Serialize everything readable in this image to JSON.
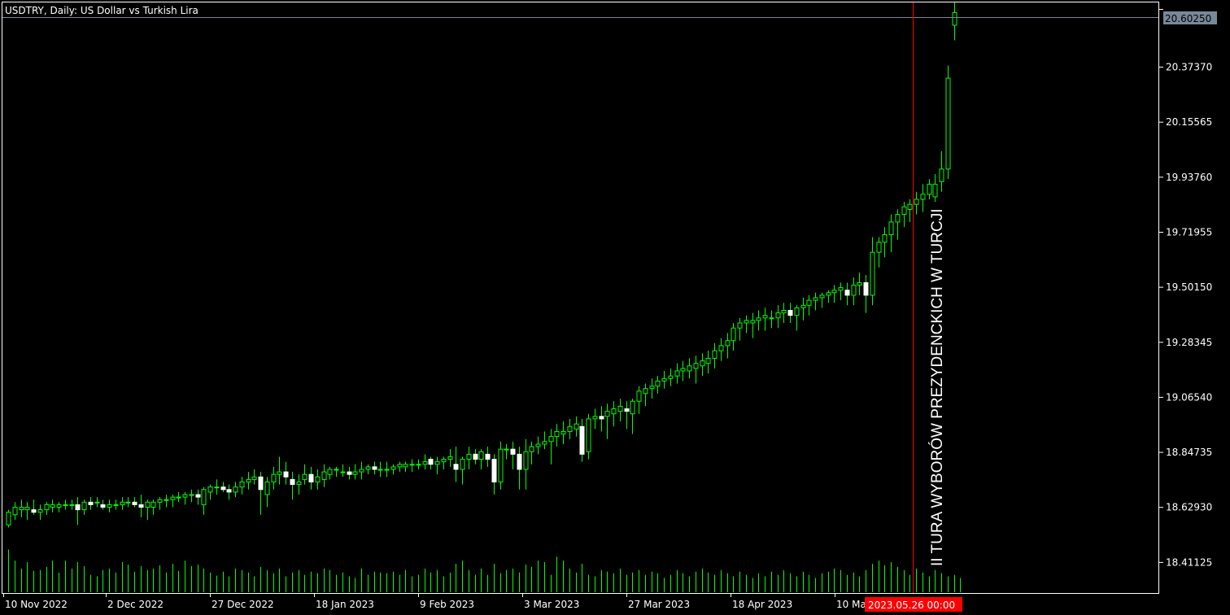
{
  "window": {
    "title": "USDTRY, Daily:  US Dollar vs Turkish Lira"
  },
  "annotation": {
    "text": "II TURA WYBORÓW PREZYDENCKICH W TURCJI",
    "marker_date_label": "2023.05.26 00:00"
  },
  "current_price_label": "20.60250",
  "colors": {
    "background": "#000000",
    "frame": "#ffffff",
    "candle": "#00ff00",
    "candle_up_body": "#000000",
    "candle_down_body": "#ffffff",
    "volume": "#00ff00",
    "marker_line": "#ff0000",
    "price_line": "#778899",
    "price_tag_bg": "#778899",
    "date_tag_bg": "#ff0000"
  },
  "chart_data": {
    "type": "candlestick",
    "title": "USDTRY, Daily:  US Dollar vs Turkish Lira",
    "symbol": "USDTRY",
    "timeframe": "Daily",
    "y_ticks": [
      "20.60250",
      "20.37370",
      "20.15565",
      "19.93760",
      "19.71955",
      "19.50150",
      "19.28345",
      "19.06540",
      "18.84735",
      "18.62930",
      "18.41125"
    ],
    "x_ticks": [
      "10 Nov 2022",
      "2 Dec 2022",
      "27 Dec 2022",
      "18 Jan 2023",
      "9 Feb 2023",
      "3 Mar 2023",
      "27 Mar 2023",
      "18 Apr 2023",
      "10 Ma"
    ],
    "ylim": [
      18.29,
      20.63
    ],
    "grid": false,
    "series": [
      {
        "values": [
          [
            18.56,
            18.62,
            18.55,
            18.61
          ],
          [
            18.6,
            18.65,
            18.58,
            18.63
          ],
          [
            18.62,
            18.66,
            18.59,
            18.63
          ],
          [
            18.62,
            18.65,
            18.58,
            18.63
          ],
          [
            18.62,
            18.66,
            18.6,
            18.61
          ],
          [
            18.61,
            18.64,
            18.58,
            18.62
          ],
          [
            18.62,
            18.65,
            18.6,
            18.64
          ],
          [
            18.63,
            18.66,
            18.61,
            18.64
          ],
          [
            18.63,
            18.65,
            18.61,
            18.64
          ],
          [
            18.64,
            18.66,
            18.62,
            18.64
          ],
          [
            18.64,
            18.66,
            18.62,
            18.64
          ],
          [
            18.64,
            18.67,
            18.56,
            18.62
          ],
          [
            18.62,
            18.66,
            18.6,
            18.65
          ],
          [
            18.65,
            18.67,
            18.62,
            18.64
          ],
          [
            18.65,
            18.67,
            18.63,
            18.65
          ],
          [
            18.64,
            18.66,
            18.62,
            18.63
          ],
          [
            18.63,
            18.66,
            18.61,
            18.64
          ],
          [
            18.64,
            18.66,
            18.62,
            18.64
          ],
          [
            18.64,
            18.67,
            18.62,
            18.65
          ],
          [
            18.65,
            18.67,
            18.63,
            18.65
          ],
          [
            18.65,
            18.67,
            18.63,
            18.64
          ],
          [
            18.64,
            18.68,
            18.59,
            18.63
          ],
          [
            18.63,
            18.66,
            18.58,
            18.65
          ],
          [
            18.63,
            18.66,
            18.6,
            18.65
          ],
          [
            18.65,
            18.67,
            18.62,
            18.66
          ],
          [
            18.66,
            18.68,
            18.63,
            18.66
          ],
          [
            18.66,
            18.68,
            18.63,
            18.67
          ],
          [
            18.67,
            18.69,
            18.65,
            18.67
          ],
          [
            18.67,
            18.69,
            18.64,
            18.68
          ],
          [
            18.68,
            18.7,
            18.65,
            18.68
          ],
          [
            18.68,
            18.7,
            18.64,
            18.67
          ],
          [
            18.64,
            18.71,
            18.6,
            18.7
          ],
          [
            18.69,
            18.72,
            18.66,
            18.71
          ],
          [
            18.71,
            18.74,
            18.68,
            18.71
          ],
          [
            18.71,
            18.73,
            18.69,
            18.7
          ],
          [
            18.7,
            18.72,
            18.66,
            18.69
          ],
          [
            18.69,
            18.73,
            18.67,
            18.71
          ],
          [
            18.71,
            18.75,
            18.68,
            18.73
          ],
          [
            18.73,
            18.77,
            18.7,
            18.74
          ],
          [
            18.74,
            18.78,
            18.72,
            18.75
          ],
          [
            18.75,
            18.77,
            18.6,
            18.7
          ],
          [
            18.68,
            18.75,
            18.63,
            18.73
          ],
          [
            18.73,
            18.79,
            18.7,
            18.76
          ],
          [
            18.76,
            18.83,
            18.72,
            18.77
          ],
          [
            18.77,
            18.81,
            18.72,
            18.75
          ],
          [
            18.74,
            18.77,
            18.66,
            18.72
          ],
          [
            18.72,
            18.76,
            18.68,
            18.73
          ],
          [
            18.74,
            18.8,
            18.72,
            18.76
          ],
          [
            18.76,
            18.79,
            18.7,
            18.73
          ],
          [
            18.73,
            18.78,
            18.7,
            18.75
          ],
          [
            18.74,
            18.8,
            18.71,
            18.77
          ],
          [
            18.76,
            18.79,
            18.74,
            18.78
          ],
          [
            18.78,
            18.79,
            18.75,
            18.78
          ],
          [
            18.77,
            18.8,
            18.75,
            18.77
          ],
          [
            18.77,
            18.79,
            18.74,
            18.76
          ],
          [
            18.76,
            18.8,
            18.74,
            18.77
          ],
          [
            18.77,
            18.81,
            18.74,
            18.78
          ],
          [
            18.78,
            18.8,
            18.76,
            18.79
          ],
          [
            18.79,
            18.81,
            18.76,
            18.78
          ],
          [
            18.78,
            18.81,
            18.75,
            18.78
          ],
          [
            18.78,
            18.81,
            18.75,
            18.78
          ],
          [
            18.78,
            18.8,
            18.76,
            18.79
          ],
          [
            18.79,
            18.81,
            18.77,
            18.8
          ],
          [
            18.79,
            18.81,
            18.77,
            18.8
          ],
          [
            18.8,
            18.82,
            18.77,
            18.8
          ],
          [
            18.8,
            18.82,
            18.78,
            18.8
          ],
          [
            18.8,
            18.84,
            18.78,
            18.81
          ],
          [
            18.82,
            18.83,
            18.78,
            18.8
          ],
          [
            18.8,
            18.83,
            18.76,
            18.81
          ],
          [
            18.81,
            18.83,
            18.78,
            18.82
          ],
          [
            18.82,
            18.86,
            18.79,
            18.83
          ],
          [
            18.8,
            18.87,
            18.73,
            18.78
          ],
          [
            18.78,
            18.83,
            18.72,
            18.82
          ],
          [
            18.82,
            18.87,
            18.78,
            18.84
          ],
          [
            18.84,
            18.86,
            18.8,
            18.82
          ],
          [
            18.82,
            18.86,
            18.78,
            18.85
          ],
          [
            18.84,
            18.87,
            18.79,
            18.82
          ],
          [
            18.82,
            18.84,
            18.68,
            18.73
          ],
          [
            18.73,
            18.89,
            18.7,
            18.86
          ],
          [
            18.86,
            18.88,
            18.82,
            18.86
          ],
          [
            18.86,
            18.89,
            18.78,
            18.84
          ],
          [
            18.84,
            18.87,
            18.7,
            18.78
          ],
          [
            18.78,
            18.9,
            18.7,
            18.85
          ],
          [
            18.85,
            18.89,
            18.8,
            18.87
          ],
          [
            18.87,
            18.91,
            18.84,
            18.88
          ],
          [
            18.88,
            18.93,
            18.86,
            18.89
          ],
          [
            18.89,
            18.94,
            18.8,
            18.91
          ],
          [
            18.91,
            18.96,
            18.87,
            18.93
          ],
          [
            18.92,
            18.97,
            18.88,
            18.93
          ],
          [
            18.93,
            18.98,
            18.9,
            18.95
          ],
          [
            18.94,
            18.99,
            18.91,
            18.96
          ],
          [
            18.95,
            18.98,
            18.81,
            18.84
          ],
          [
            18.85,
            19.0,
            18.82,
            18.98
          ],
          [
            18.98,
            19.02,
            18.94,
            18.99
          ],
          [
            18.99,
            19.03,
            18.93,
            18.98
          ],
          [
            18.99,
            19.04,
            18.9,
            19.01
          ],
          [
            19.0,
            19.05,
            18.95,
            19.02
          ],
          [
            19.01,
            19.06,
            18.97,
            19.03
          ],
          [
            19.02,
            19.05,
            18.94,
            19.01
          ],
          [
            19.0,
            19.06,
            18.92,
            19.05
          ],
          [
            19.05,
            19.11,
            19.0,
            19.09
          ],
          [
            19.08,
            19.12,
            19.03,
            19.1
          ],
          [
            19.1,
            19.14,
            19.06,
            19.11
          ],
          [
            19.11,
            19.15,
            19.08,
            19.13
          ],
          [
            19.13,
            19.17,
            19.1,
            19.14
          ],
          [
            19.14,
            19.18,
            19.11,
            19.15
          ],
          [
            19.15,
            19.2,
            19.12,
            19.17
          ],
          [
            19.17,
            19.21,
            19.13,
            19.18
          ],
          [
            19.17,
            19.22,
            19.14,
            19.19
          ],
          [
            19.18,
            19.23,
            19.12,
            19.2
          ],
          [
            19.19,
            19.24,
            19.15,
            19.21
          ],
          [
            19.2,
            19.25,
            19.16,
            19.22
          ],
          [
            19.22,
            19.28,
            19.18,
            19.25
          ],
          [
            19.25,
            19.3,
            19.21,
            19.27
          ],
          [
            19.27,
            19.32,
            19.22,
            19.29
          ],
          [
            19.29,
            19.36,
            19.25,
            19.34
          ],
          [
            19.34,
            19.38,
            19.29,
            19.36
          ],
          [
            19.36,
            19.39,
            19.32,
            19.37
          ],
          [
            19.36,
            19.4,
            19.3,
            19.37
          ],
          [
            19.37,
            19.41,
            19.33,
            19.38
          ],
          [
            19.38,
            19.42,
            19.33,
            19.39
          ],
          [
            19.38,
            19.41,
            19.34,
            19.38
          ],
          [
            19.38,
            19.43,
            19.34,
            19.4
          ],
          [
            19.4,
            19.44,
            19.36,
            19.41
          ],
          [
            19.41,
            19.44,
            19.36,
            19.39
          ],
          [
            19.39,
            19.43,
            19.33,
            19.42
          ],
          [
            19.42,
            19.46,
            19.37,
            19.43
          ],
          [
            19.43,
            19.47,
            19.39,
            19.45
          ],
          [
            19.45,
            19.48,
            19.41,
            19.46
          ],
          [
            19.46,
            19.48,
            19.42,
            19.47
          ],
          [
            19.47,
            19.49,
            19.44,
            19.48
          ],
          [
            19.48,
            19.51,
            19.44,
            19.49
          ],
          [
            19.49,
            19.52,
            19.45,
            19.5
          ],
          [
            19.49,
            19.52,
            19.43,
            19.47
          ],
          [
            19.47,
            19.54,
            19.43,
            19.51
          ],
          [
            19.51,
            19.56,
            19.47,
            19.52
          ],
          [
            19.52,
            19.55,
            19.4,
            19.47
          ],
          [
            19.47,
            19.7,
            19.43,
            19.64
          ],
          [
            19.64,
            19.7,
            19.58,
            19.68
          ],
          [
            19.68,
            19.74,
            19.62,
            19.71
          ],
          [
            19.71,
            19.79,
            19.64,
            19.76
          ],
          [
            19.76,
            19.81,
            19.69,
            19.79
          ],
          [
            19.79,
            19.84,
            19.74,
            19.82
          ],
          [
            19.81,
            19.85,
            19.76,
            19.83
          ],
          [
            19.83,
            19.88,
            19.79,
            19.85
          ],
          [
            19.85,
            19.91,
            19.8,
            19.87
          ],
          [
            19.87,
            19.93,
            19.85,
            19.91
          ],
          [
            19.86,
            19.95,
            19.84,
            19.91
          ],
          [
            19.92,
            20.04,
            19.88,
            19.97
          ],
          [
            19.97,
            20.38,
            19.93,
            20.33
          ],
          [
            20.54,
            20.63,
            20.48,
            20.59
          ]
        ],
        "volumes": [
          54,
          40,
          30,
          38,
          27,
          28,
          32,
          40,
          25,
          40,
          30,
          38,
          33,
          22,
          20,
          28,
          30,
          25,
          38,
          35,
          26,
          33,
          28,
          30,
          34,
          25,
          36,
          27,
          40,
          33,
          35,
          30,
          25,
          21,
          26,
          20,
          30,
          28,
          25,
          20,
          32,
          28,
          24,
          30,
          20,
          25,
          28,
          22,
          26,
          24,
          30,
          28,
          22,
          25,
          20,
          18,
          30,
          22,
          26,
          25,
          24,
          26,
          22,
          28,
          20,
          22,
          30,
          25,
          28,
          20,
          25,
          36,
          40,
          28,
          22,
          30,
          22,
          36,
          24,
          28,
          30,
          25,
          35,
          32,
          40,
          38,
          22,
          45,
          40,
          30,
          25,
          36,
          22,
          20,
          28,
          26,
          24,
          30,
          22,
          25,
          28,
          22,
          26,
          24,
          18,
          22,
          28,
          24,
          20,
          26,
          30,
          25,
          22,
          28,
          24,
          20,
          26,
          22,
          18,
          24,
          20,
          26,
          22,
          28,
          24,
          20,
          26,
          22,
          18,
          24,
          26,
          30,
          28,
          22,
          25,
          20,
          28,
          36,
          40,
          34,
          38,
          32,
          28,
          22,
          30,
          25,
          20,
          28,
          24,
          20,
          22,
          18
        ]
      }
    ]
  }
}
